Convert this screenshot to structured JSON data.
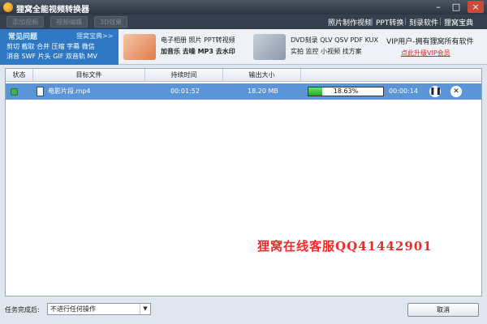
{
  "window": {
    "title": "狸窝全能视频转换器"
  },
  "toolbar": {
    "buttons": [
      "添加视频",
      "视频编辑",
      "3D效果"
    ],
    "links": [
      "照片制作视频",
      "PPT转换",
      "刻录软件",
      "狸窝宝典"
    ]
  },
  "faq": {
    "title": "常见问题",
    "more": "狸窝宝典>>",
    "line1": "剪切 截取 合并 压缩 字幕 微信",
    "line2": "消音 SWF 片头 GIF 双音轨 MV"
  },
  "promo1": {
    "line1": "电子相册 照片 PPT转视频",
    "line2": "加音乐 去噪 MP3 去水印"
  },
  "promo2": {
    "line1": "DVD刻录 QLV QSV PDF KUX",
    "line2": "实拍 监控 小视频 找方案"
  },
  "vip": {
    "line1": "VIP用户-拥有狸窝所有软件",
    "link": "点此升级VIP会员"
  },
  "table": {
    "headers": [
      "状态",
      "目标文件",
      "持续时间",
      "输出大小"
    ],
    "rows": [
      {
        "file": "电影片段.mp4",
        "duration": "00:01:52",
        "size": "18.20 MB",
        "progress_text": "18.63%",
        "progress": 0.1863,
        "elapsed": "00:00:14"
      }
    ]
  },
  "watermark": "狸窝在线客服QQ41442901",
  "footer": {
    "label": "任务完成后:",
    "select_value": "不进行任何操作",
    "cancel_label": "取消"
  }
}
